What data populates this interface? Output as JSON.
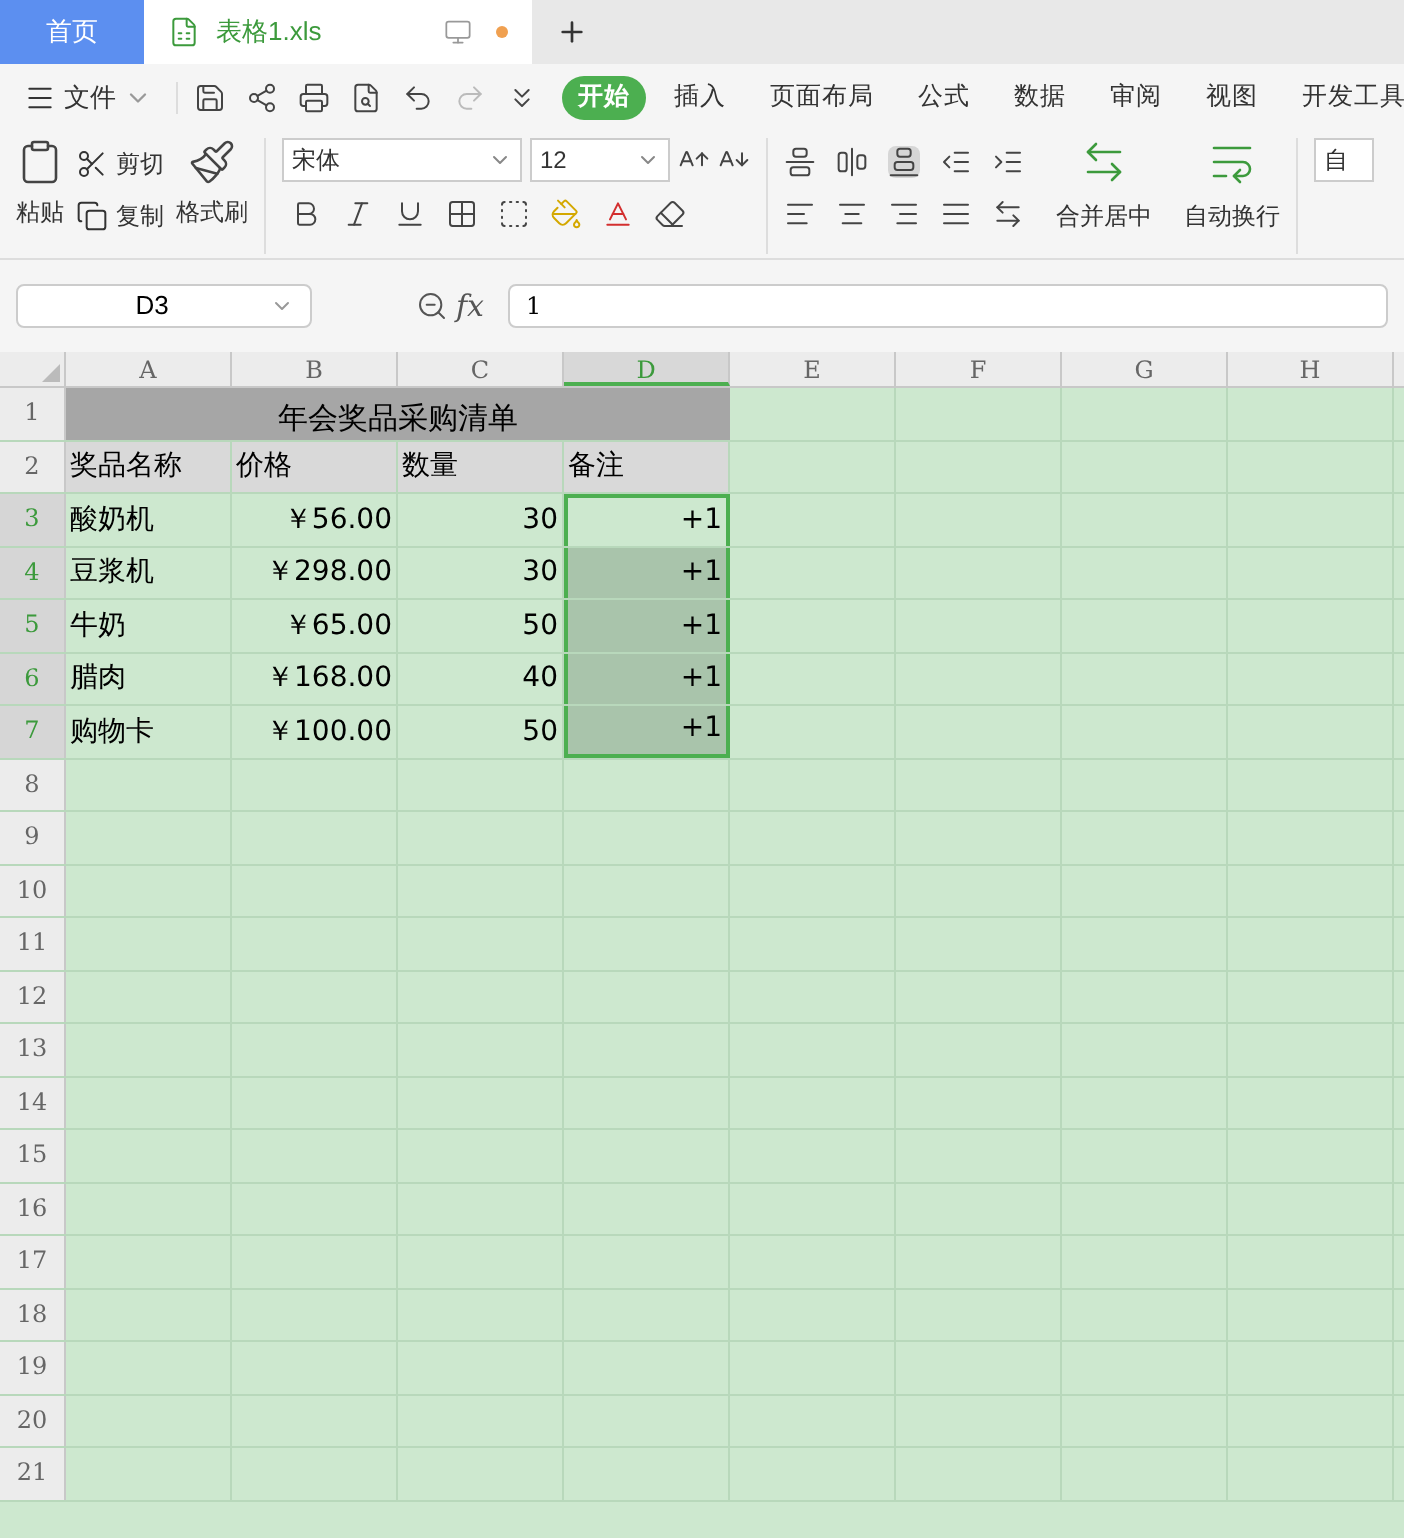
{
  "doc_tabs": [
    {
      "label": "首页",
      "kind": "home",
      "selected": false
    },
    {
      "label": "表格1.xls",
      "kind": "file",
      "selected": true,
      "unsaved": true
    }
  ],
  "menu": {
    "file_label": "文件"
  },
  "ribbon_tabs": [
    {
      "label": "开始",
      "selected": true
    },
    {
      "label": "插入",
      "selected": false
    },
    {
      "label": "页面布局",
      "selected": false
    },
    {
      "label": "公式",
      "selected": false
    },
    {
      "label": "数据",
      "selected": false
    },
    {
      "label": "审阅",
      "selected": false
    },
    {
      "label": "视图",
      "selected": false
    },
    {
      "label": "开发工具",
      "selected": false
    }
  ],
  "ribbon": {
    "paste": "粘贴",
    "cut": "剪切",
    "copy": "复制",
    "format_painter": "格式刷",
    "font": "宋体",
    "font_size": "12",
    "merge": "合并居中",
    "wrap": "自动换行",
    "next_field": "自"
  },
  "formula_bar": {
    "cell_ref": "D3",
    "fx": "fx",
    "value": "1"
  },
  "columns": [
    {
      "label": "A",
      "selected": false
    },
    {
      "label": "B",
      "selected": false
    },
    {
      "label": "C",
      "selected": false
    },
    {
      "label": "D",
      "selected": true
    },
    {
      "label": "E",
      "selected": false
    },
    {
      "label": "F",
      "selected": false
    },
    {
      "label": "G",
      "selected": false
    },
    {
      "label": "H",
      "selected": false
    }
  ],
  "rows": [
    {
      "label": "1",
      "selected": false,
      "kind": "title",
      "cells": [
        {
          "text": "年会奖品采购清单"
        }
      ]
    },
    {
      "label": "2",
      "selected": false,
      "kind": "header",
      "cells": [
        {
          "text": "奖品名称"
        },
        {
          "text": "价格"
        },
        {
          "text": "数量"
        },
        {
          "text": "备注"
        }
      ]
    },
    {
      "label": "3",
      "selected": true,
      "kind": "data",
      "cells": [
        {
          "text": "酸奶机"
        },
        {
          "text": "￥56.00"
        },
        {
          "text": "30"
        },
        {
          "text": "+1",
          "selected": true,
          "active": true
        }
      ]
    },
    {
      "label": "4",
      "selected": true,
      "kind": "data",
      "cells": [
        {
          "text": "豆浆机"
        },
        {
          "text": "￥298.00"
        },
        {
          "text": "30"
        },
        {
          "text": "+1",
          "selected": true,
          "active": false
        }
      ]
    },
    {
      "label": "5",
      "selected": true,
      "kind": "data",
      "cells": [
        {
          "text": "牛奶"
        },
        {
          "text": "￥65.00"
        },
        {
          "text": "50"
        },
        {
          "text": "+1",
          "selected": true,
          "active": false
        }
      ]
    },
    {
      "label": "6",
      "selected": true,
      "kind": "data",
      "cells": [
        {
          "text": "腊肉"
        },
        {
          "text": "￥168.00"
        },
        {
          "text": "40"
        },
        {
          "text": "+1",
          "selected": true,
          "active": false
        }
      ]
    },
    {
      "label": "7",
      "selected": true,
      "kind": "data",
      "cells": [
        {
          "text": "购物卡"
        },
        {
          "text": "￥100.00"
        },
        {
          "text": "50"
        },
        {
          "text": "+1",
          "selected": true,
          "active": false
        }
      ]
    },
    {
      "label": "8",
      "selected": false,
      "kind": "empty",
      "cells": []
    },
    {
      "label": "9",
      "selected": false,
      "kind": "empty",
      "cells": []
    },
    {
      "label": "10",
      "selected": false,
      "kind": "empty",
      "cells": []
    },
    {
      "label": "11",
      "selected": false,
      "kind": "empty",
      "cells": []
    },
    {
      "label": "12",
      "selected": false,
      "kind": "empty",
      "cells": []
    },
    {
      "label": "13",
      "selected": false,
      "kind": "empty",
      "cells": []
    },
    {
      "label": "14",
      "selected": false,
      "kind": "empty",
      "cells": []
    },
    {
      "label": "15",
      "selected": false,
      "kind": "empty",
      "cells": []
    },
    {
      "label": "16",
      "selected": false,
      "kind": "empty",
      "cells": []
    },
    {
      "label": "17",
      "selected": false,
      "kind": "empty",
      "cells": []
    },
    {
      "label": "18",
      "selected": false,
      "kind": "empty",
      "cells": []
    },
    {
      "label": "19",
      "selected": false,
      "kind": "empty",
      "cells": []
    },
    {
      "label": "20",
      "selected": false,
      "kind": "empty",
      "cells": []
    },
    {
      "label": "21",
      "selected": false,
      "kind": "empty",
      "cells": []
    }
  ]
}
